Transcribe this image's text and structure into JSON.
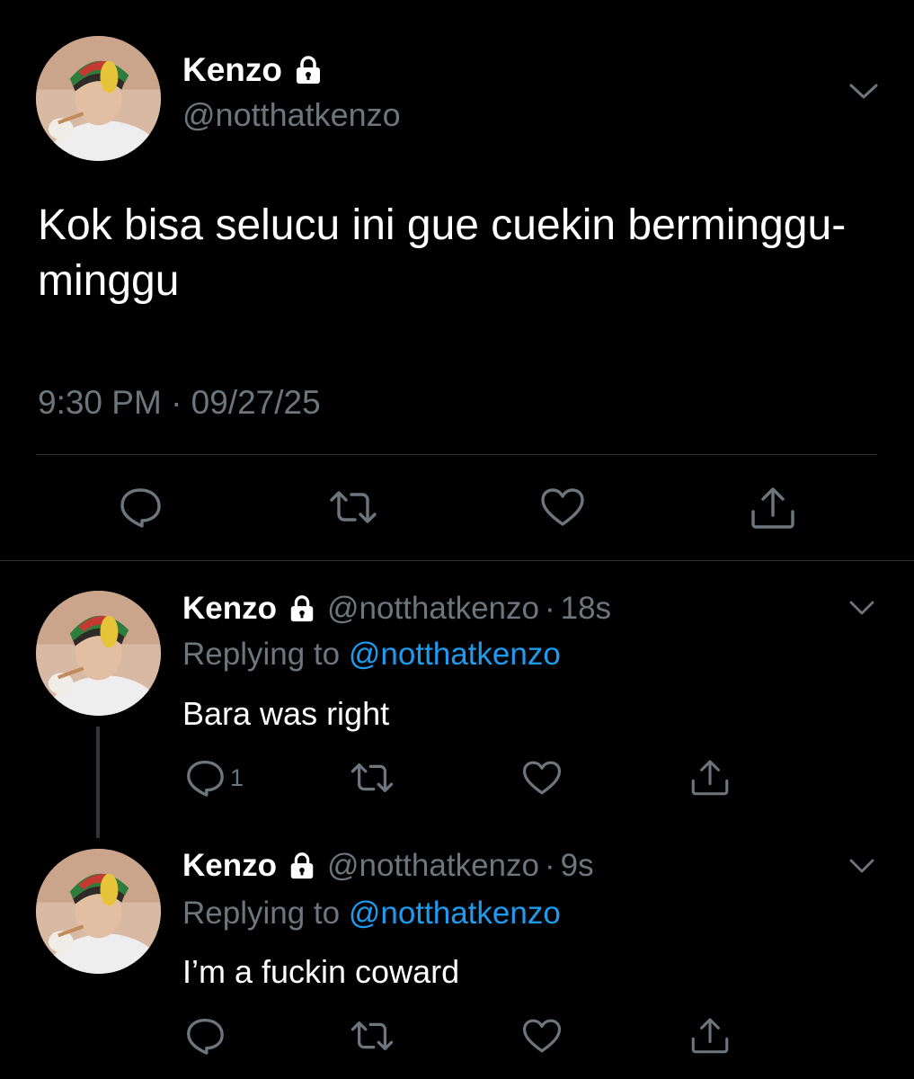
{
  "main_tweet": {
    "name": "Kenzo",
    "handle": "@notthatkenzo",
    "text": "Kok bisa selucu ini gue cuekin berminggu-minggu",
    "timestamp": "9:30 PM · 09/27/25",
    "actions": [
      "reply-icon",
      "retweet-icon",
      "like-icon",
      "share-icon"
    ]
  },
  "replies": [
    {
      "name": "Kenzo",
      "handle": "@notthatkenzo",
      "dot": "·",
      "time": "18s",
      "replying_label": "Replying to",
      "replying_handle": "@notthatkenzo",
      "text": "Bara was right",
      "reply_count": "1"
    },
    {
      "name": "Kenzo",
      "handle": "@notthatkenzo",
      "dot": "·",
      "time": "9s",
      "replying_label": "Replying to",
      "replying_handle": "@notthatkenzo",
      "text": "I’m a fuckin coward",
      "reply_count": ""
    }
  ],
  "colors": {
    "background": "#000000",
    "primary_text": "#ffffff",
    "secondary_text": "#6e767d",
    "link": "#1d9bf0",
    "divider": "#2f3336"
  }
}
